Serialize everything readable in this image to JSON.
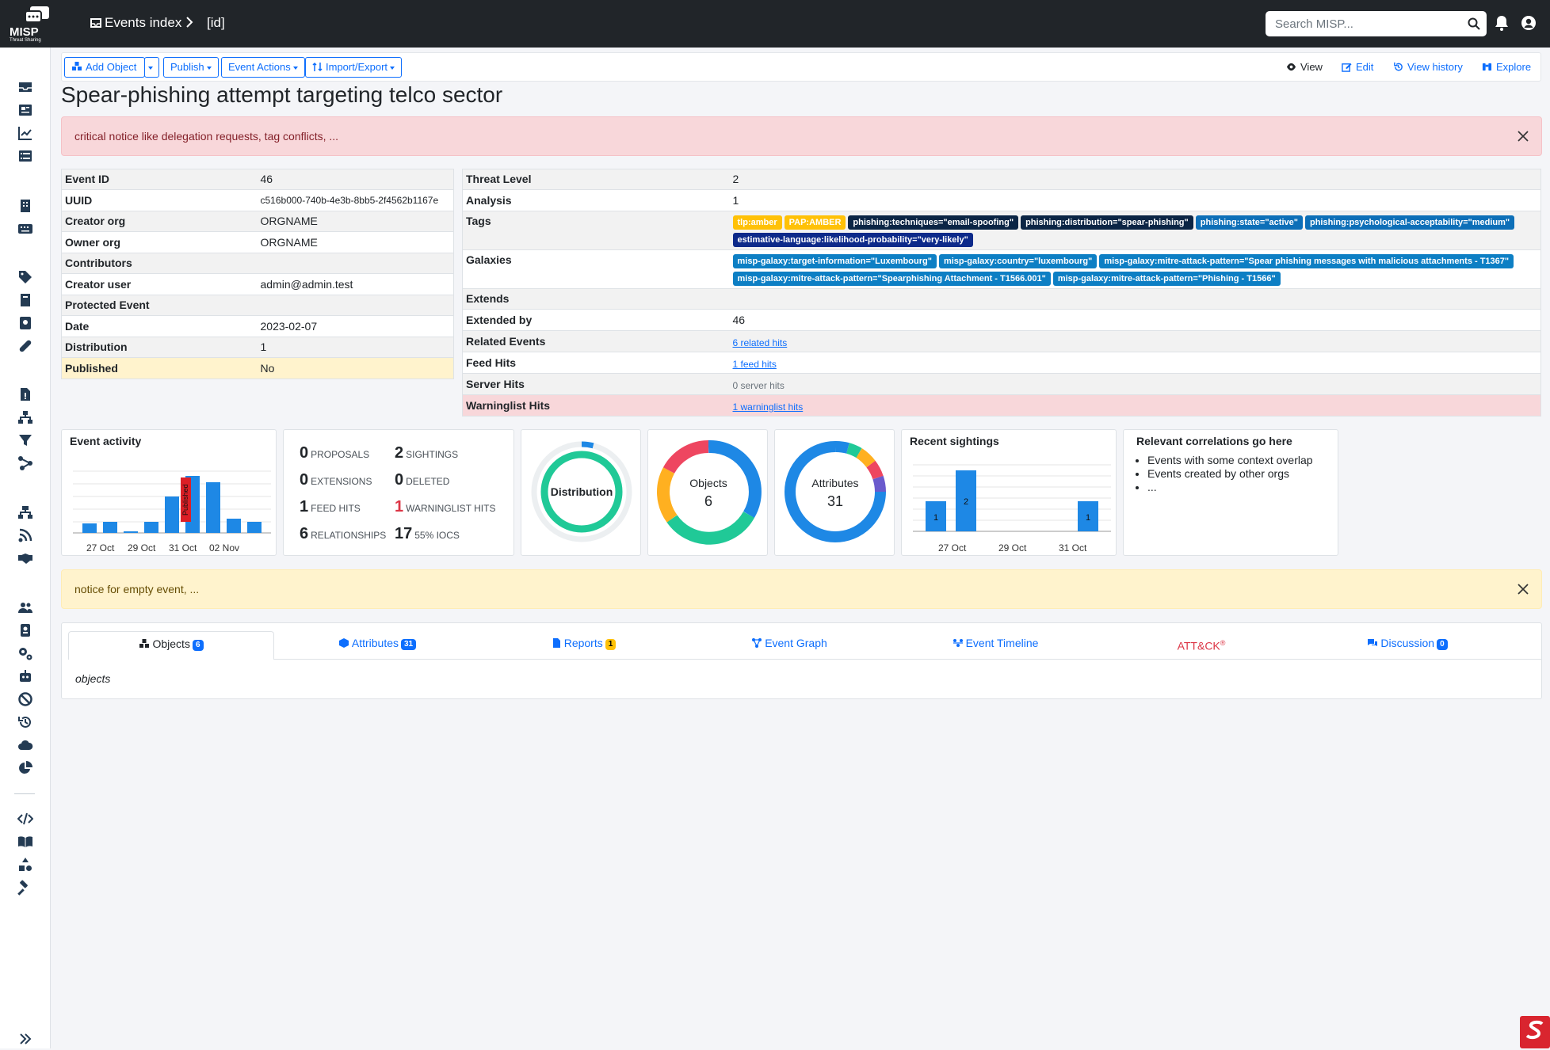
{
  "topbar": {
    "logo_text": "MISP",
    "logo_sub": "Threat Sharing",
    "breadcrumb_events": "Events index",
    "breadcrumb_id": "[id]",
    "search_placeholder": "Search MISP..."
  },
  "toolbar": {
    "add_object": "Add Object",
    "publish": "Publish",
    "event_actions": "Event Actions",
    "import_export": "Import/Export",
    "view": "View",
    "edit": "Edit",
    "view_history": "View history",
    "explore": "Explore"
  },
  "page_title": "Spear-phishing attempt targeting telco sector",
  "alerts": {
    "danger": "critical notice like delegation requests, tag conflicts, ...",
    "warning": "notice for empty event, ..."
  },
  "event_meta": [
    {
      "key": "Event ID",
      "value": "46"
    },
    {
      "key": "UUID",
      "value": "c516b000-740b-4e3b-8bb5-2f4562b1167e"
    },
    {
      "key": "Creator org",
      "value": "ORGNAME"
    },
    {
      "key": "Owner org",
      "value": "ORGNAME"
    },
    {
      "key": "Contributors",
      "value": ""
    },
    {
      "key": "Creator user",
      "value": "admin@admin.test"
    },
    {
      "key": "Protected Event",
      "value": ""
    },
    {
      "key": "Date",
      "value": "2023-02-07"
    },
    {
      "key": "Distribution",
      "value": "1"
    },
    {
      "key": "Published",
      "value": "No"
    }
  ],
  "event_info": {
    "threat_level": {
      "key": "Threat Level",
      "value": "2"
    },
    "analysis": {
      "key": "Analysis",
      "value": "1"
    },
    "tags_label": "Tags",
    "tags": [
      {
        "label": "tlp:amber",
        "color": "#ffc107"
      },
      {
        "label": "PAP:AMBER",
        "color": "#ffc107"
      },
      {
        "label": "phishing:techniques=\"email-spoofing\"",
        "color": "#0b2545"
      },
      {
        "label": "phishing:distribution=\"spear-phishing\"",
        "color": "#0b2545"
      },
      {
        "label": "phishing:state=\"active\"",
        "color": "#0d6fb8"
      },
      {
        "label": "phishing:psychological-acceptability=\"medium\"",
        "color": "#0d6fb8"
      },
      {
        "label": "estimative-language:likelihood-probability=\"very-likely\"",
        "color": "#0d2a8a"
      }
    ],
    "galaxies_label": "Galaxies",
    "galaxies": [
      "misp-galaxy:target-information=\"Luxembourg\"",
      "misp-galaxy:country=\"luxembourg\"",
      "misp-galaxy:mitre-attack-pattern=\"Spear phishing messages with malicious attachments - T1367\"",
      "misp-galaxy:mitre-attack-pattern=\"Spearphishing Attachment - T1566.001\"",
      "misp-galaxy:mitre-attack-pattern=\"Phishing - T1566\""
    ],
    "galaxy_color": "#0d7fc4",
    "extends": {
      "key": "Extends",
      "value": ""
    },
    "extended_by": {
      "key": "Extended by",
      "value": "46"
    },
    "related_events": {
      "key": "Related Events",
      "value": "6 related hits"
    },
    "feed_hits": {
      "key": "Feed Hits",
      "value": "1 feed hits"
    },
    "server_hits": {
      "key": "Server Hits",
      "value": "0 server hits"
    },
    "warninglist_hits": {
      "key": "Warninglist Hits",
      "value": "1 warninglist hits"
    }
  },
  "event_activity": {
    "title": "Event activity",
    "published_marker": "Published",
    "tick_labels": [
      "27 Oct",
      "29 Oct",
      "31 Oct",
      "02 Nov"
    ]
  },
  "stats": [
    {
      "value": "0",
      "label": "PROPOSALS"
    },
    {
      "value": "2",
      "label": "SIGHTINGS"
    },
    {
      "value": "0",
      "label": "EXTENSIONS"
    },
    {
      "value": "0",
      "label": "DELETED"
    },
    {
      "value": "1",
      "label": "FEED HITS"
    },
    {
      "value": "1",
      "label": "WARNINGLIST HITS"
    },
    {
      "value": "6",
      "label": "RELATIONSHIPS"
    },
    {
      "value": "17",
      "label": "55% IOCS"
    }
  ],
  "donuts": {
    "distribution_label": "Distribution",
    "objects_label": "Objects",
    "objects_count": "6",
    "attributes_label": "Attributes",
    "attributes_count": "31",
    "distribution_color": "#20c997",
    "objects_colors": [
      "#0d7fe8",
      "#20c997",
      "#ffb020",
      "#ee4660"
    ],
    "attributes_colors": [
      "#0d7fe8",
      "#6a5acd",
      "#ee4660",
      "#ffb020",
      "#20c997"
    ]
  },
  "recent_sightings": {
    "title": "Recent sightings",
    "bar_labels": [
      "1",
      "2",
      "1"
    ],
    "tick_labels": [
      "27 Oct",
      "29 Oct",
      "31 Oct"
    ]
  },
  "correlations": {
    "title": "Relevant correlations go here",
    "items": [
      "Events with some context overlap",
      "Events created by other orgs",
      "..."
    ]
  },
  "tabs": [
    {
      "label": "Objects",
      "count": "6"
    },
    {
      "label": "Attributes",
      "count": "31"
    },
    {
      "label": "Reports",
      "count": "1"
    },
    {
      "label": "Event Graph"
    },
    {
      "label": "Event Timeline"
    },
    {
      "label": "ATT&CK",
      "sup": "®"
    },
    {
      "label": "Discussion",
      "count": "0"
    }
  ],
  "tab_content": "objects"
}
